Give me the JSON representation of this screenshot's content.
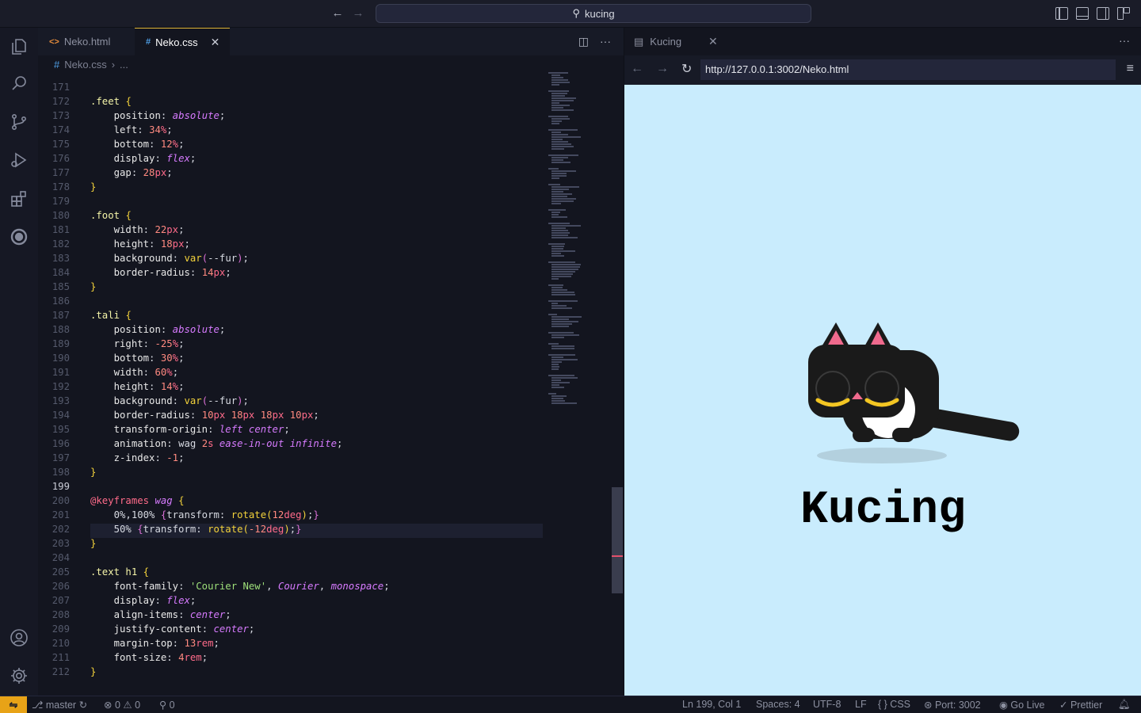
{
  "titlebar": {
    "search_text": "kucing"
  },
  "activity_icons": [
    "explorer-icon",
    "search-icon",
    "source-control-icon",
    "run-debug-icon",
    "extensions-icon",
    "remote-icon",
    "account-icon",
    "settings-gear-icon"
  ],
  "editor": {
    "tabs": [
      {
        "label": "Neko.html",
        "icon": "<>"
      },
      {
        "label": "Neko.css",
        "icon": "#"
      }
    ],
    "breadcrumb": {
      "file": "Neko.css",
      "rest": "..."
    },
    "current_line": 199
  },
  "browser": {
    "tab_label": "Kucing",
    "url": "http://127.0.0.1:3002/Neko.html",
    "heading": "Kucing",
    "colors": {
      "background": "#c9ecfd",
      "fur": "#1a1a1a",
      "ear_inner": "#f06a8d",
      "eye": "#f3c623"
    }
  },
  "status": {
    "branch": "master",
    "errors": "0",
    "warnings": "0",
    "ports": "0",
    "position": "Ln 199, Col 1",
    "spaces": "Spaces: 4",
    "encoding": "UTF-8",
    "eol": "LF",
    "language": "CSS",
    "port": "Port: 3002",
    "golive": "Go Live",
    "prettier": "Prettier"
  }
}
